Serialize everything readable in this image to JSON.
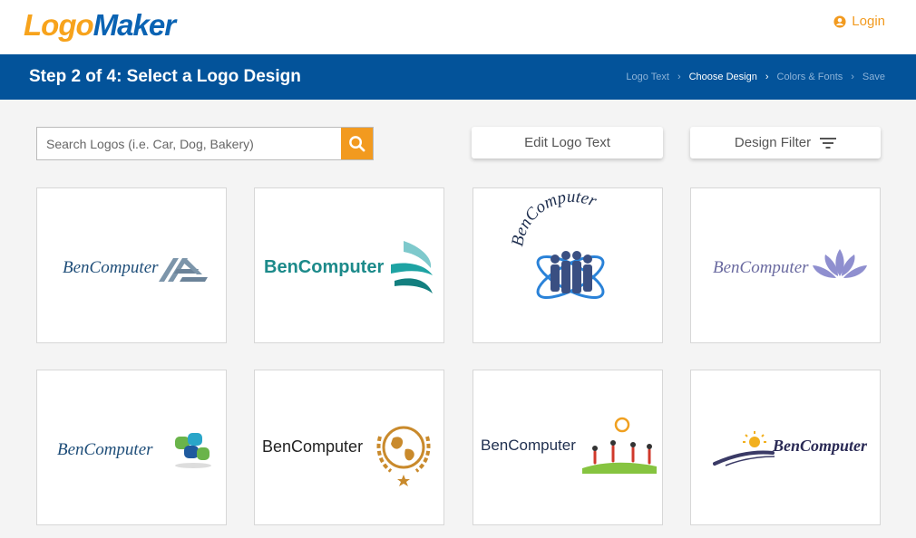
{
  "brand": {
    "logo_part1": "Logo",
    "logo_part2": "Maker",
    "color_orange": "#f29a1f",
    "color_blue": "#03539a"
  },
  "header": {
    "login_label": "Login"
  },
  "step": {
    "title": "Step 2 of 4: Select a Logo Design",
    "breadcrumbs": [
      "Logo Text",
      "Choose Design",
      "Colors & Fonts",
      "Save"
    ],
    "active_index": 1
  },
  "toolbar": {
    "search_placeholder": "Search Logos (i.e. Car, Dog, Bakery)",
    "edit_label": "Edit Logo Text",
    "filter_label": "Design Filter"
  },
  "logos": [
    {
      "text": "BenComputer",
      "icon": "triangle-stripes-icon"
    },
    {
      "text": "BenComputer",
      "icon": "teal-wings-icon"
    },
    {
      "text": "BenComputer",
      "icon": "people-globe-orbit-icon"
    },
    {
      "text": "BenComputer",
      "icon": "lotus-icon"
    },
    {
      "text": "BenComputer",
      "icon": "puzzle-cross-icon"
    },
    {
      "text": "BenComputer",
      "icon": "globe-laurel-icon"
    },
    {
      "text": "BenComputer",
      "icon": "kids-sun-icon"
    },
    {
      "text": "BenComputer",
      "icon": "sun-road-icon"
    }
  ]
}
